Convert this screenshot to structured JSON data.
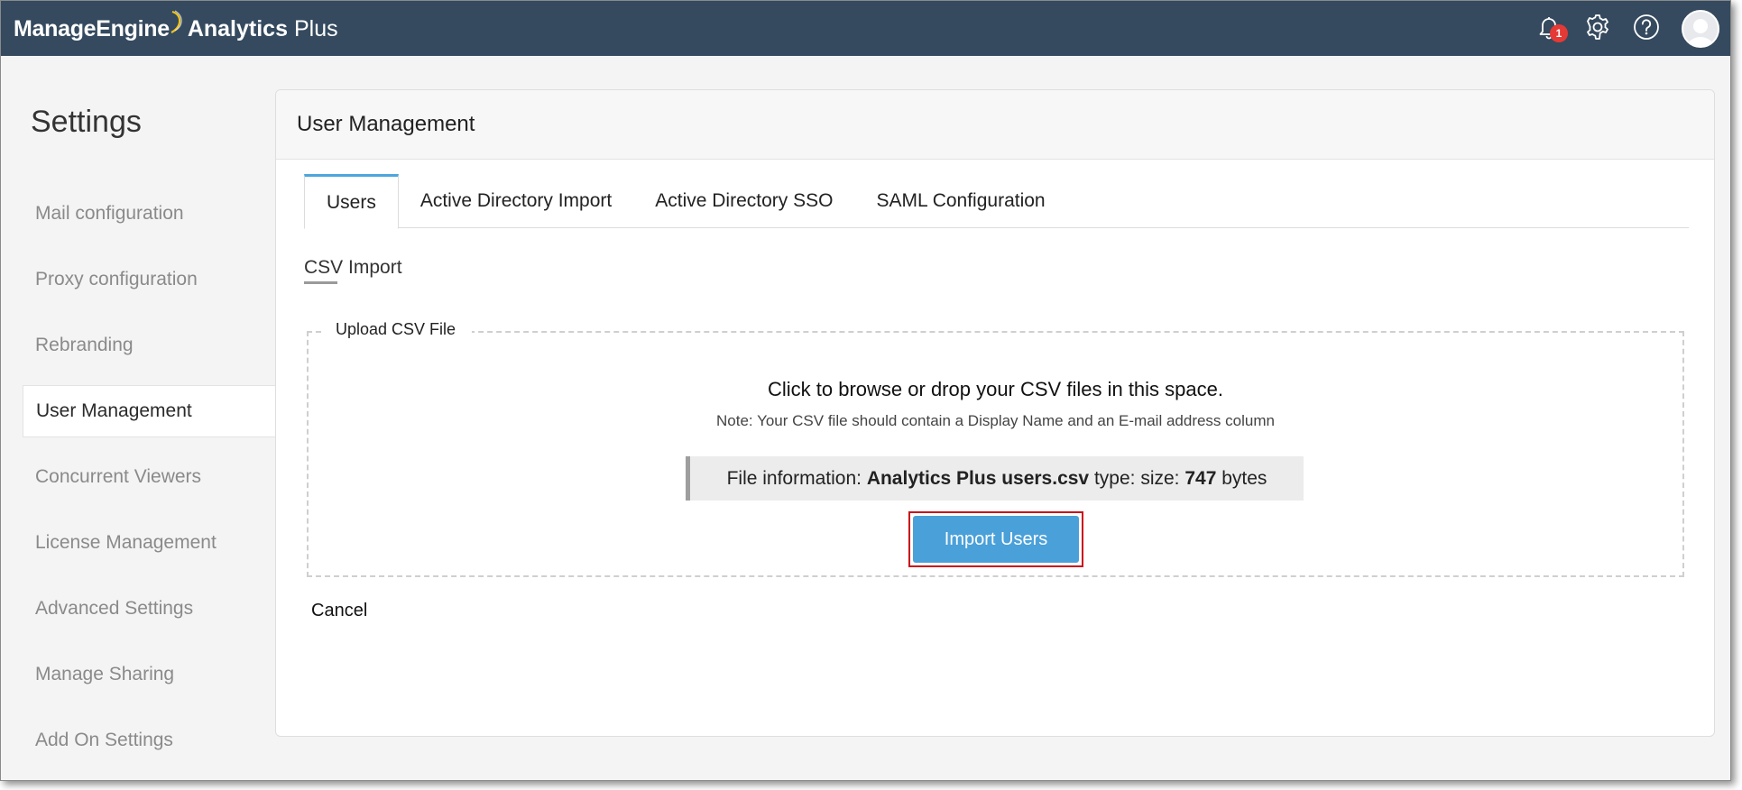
{
  "app": {
    "brand_primary": "ManageEngine",
    "brand_secondary": "Analytics",
    "brand_suffix": "Plus",
    "notification_count": "1",
    "header_color": "#354a5f",
    "accent_color": "#4aa0d9",
    "icons": [
      "bell-icon",
      "gear-icon",
      "help-icon",
      "user-avatar-icon"
    ]
  },
  "sidebar": {
    "title": "Settings",
    "items": [
      {
        "label": "Mail configuration",
        "active": false
      },
      {
        "label": "Proxy configuration",
        "active": false
      },
      {
        "label": "Rebranding",
        "active": false
      },
      {
        "label": "User Management",
        "active": true
      },
      {
        "label": "Concurrent Viewers",
        "active": false
      },
      {
        "label": "License Management",
        "active": false
      },
      {
        "label": "Advanced Settings",
        "active": false
      },
      {
        "label": "Manage Sharing",
        "active": false
      },
      {
        "label": "Add On Settings",
        "active": false
      }
    ]
  },
  "main": {
    "title": "User Management",
    "tabs": [
      {
        "label": "Users",
        "active": true
      },
      {
        "label": "Active Directory Import",
        "active": false
      },
      {
        "label": "Active Directory SSO",
        "active": false
      },
      {
        "label": "SAML Configuration",
        "active": false
      }
    ],
    "section_title": "CSV Import",
    "upload": {
      "legend": "Upload CSV File",
      "instruction": "Click to browse or drop your CSV files in this space.",
      "note": "Note: Your CSV file should contain a Display Name and an E-mail address column",
      "file_info_prefix": "File information: ",
      "file_name": "Analytics Plus users.csv",
      "file_info_middle": " type: size: ",
      "file_size": "747",
      "file_info_suffix": " bytes"
    },
    "import_button": "Import Users",
    "cancel": "Cancel"
  }
}
